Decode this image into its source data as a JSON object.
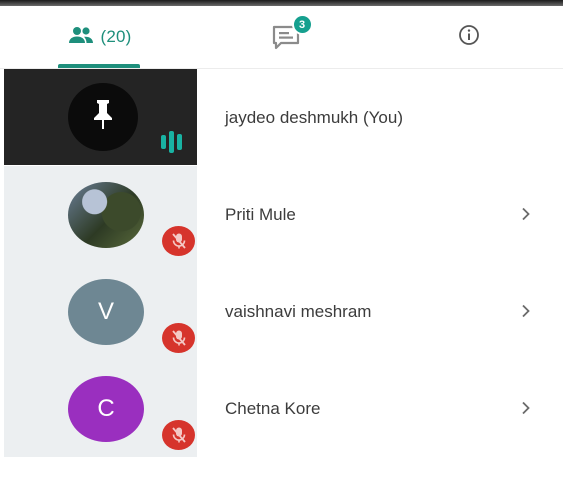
{
  "tabs": {
    "people": {
      "count_label": "(20)",
      "icon": "people-icon"
    },
    "chat": {
      "badge": "3",
      "icon": "chat-icon"
    },
    "info": {
      "icon": "info-icon"
    }
  },
  "colors": {
    "accent": "#1e8f7c",
    "badge": "#16a08f",
    "mute": "#d6342c",
    "avatar_v": "#6e8793",
    "avatar_c": "#9a2fbf"
  },
  "participants": [
    {
      "name": "jaydeo deshmukh (You)",
      "avatar": "pin-icon",
      "status": "speaking"
    },
    {
      "name": "Priti Mule",
      "avatar": "photo",
      "status": "muted"
    },
    {
      "name": "vaishnavi meshram",
      "initial": "V",
      "status": "muted"
    },
    {
      "name": "Chetna Kore",
      "initial": "C",
      "status": "muted"
    }
  ]
}
